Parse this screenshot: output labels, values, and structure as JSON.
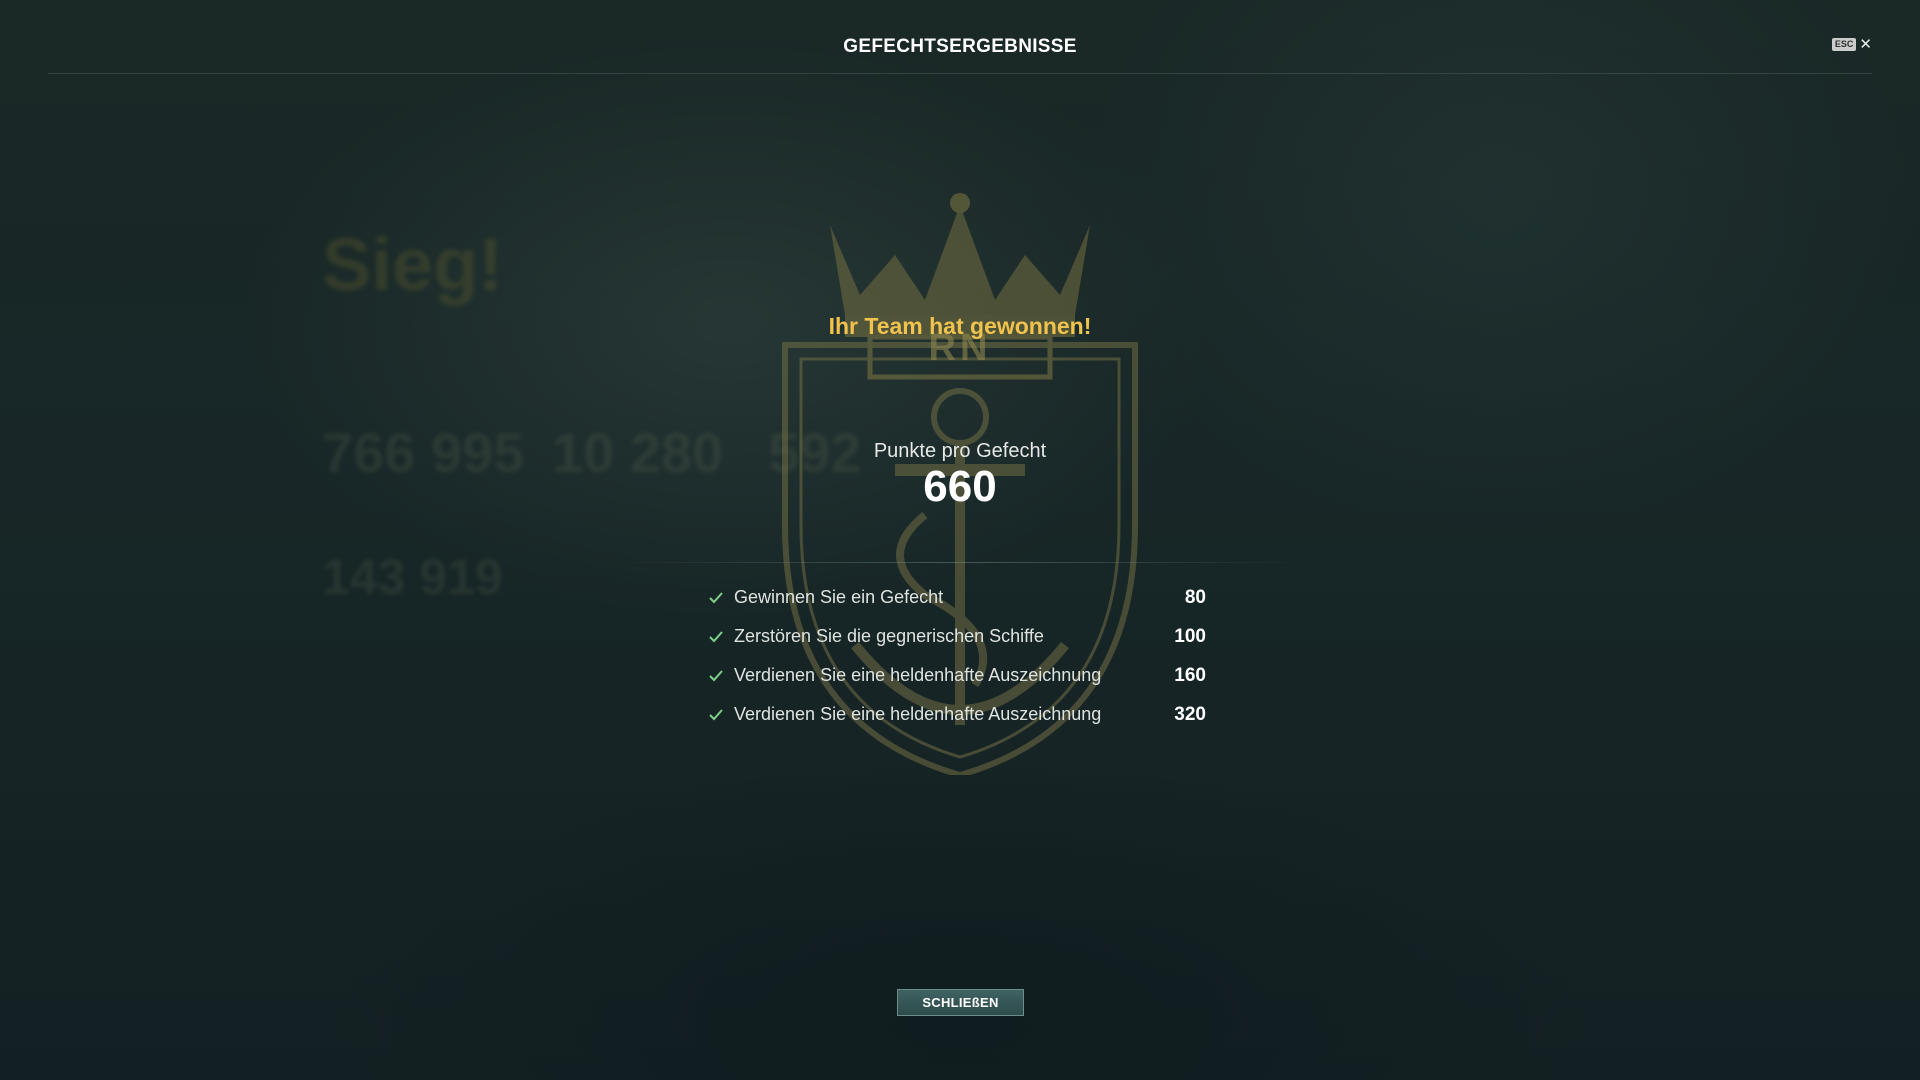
{
  "header": {
    "title": "GEFECHTSERGEBNISSE",
    "esc_key": "ESC",
    "close_glyph": "✕"
  },
  "background": {
    "result_title": "Sieg!",
    "stat_values": [
      "766 995",
      "10 280",
      "592"
    ],
    "credits_value": "143 919"
  },
  "emblem": {
    "icon": "royal-navy-crest-icon",
    "letters": "RN"
  },
  "result": {
    "headline": "Ihr Team hat gewonnen!",
    "points_label": "Punkte pro Gefecht",
    "points_value": "660"
  },
  "tasks": [
    {
      "label": "Gewinnen Sie ein Gefecht",
      "points": "80"
    },
    {
      "label": "Zerstören Sie die gegnerischen Schiffe",
      "points": "100"
    },
    {
      "label": "Verdienen Sie eine heldenhafte Auszeichnung",
      "points": "160"
    },
    {
      "label": "Verdienen Sie eine heldenhafte Auszeichnung",
      "points": "320"
    }
  ],
  "footer": {
    "close_label": "SCHLIEßEN"
  },
  "colors": {
    "headline": "#f0c24e",
    "check": "#7fd08a",
    "button": "#3f6262"
  }
}
